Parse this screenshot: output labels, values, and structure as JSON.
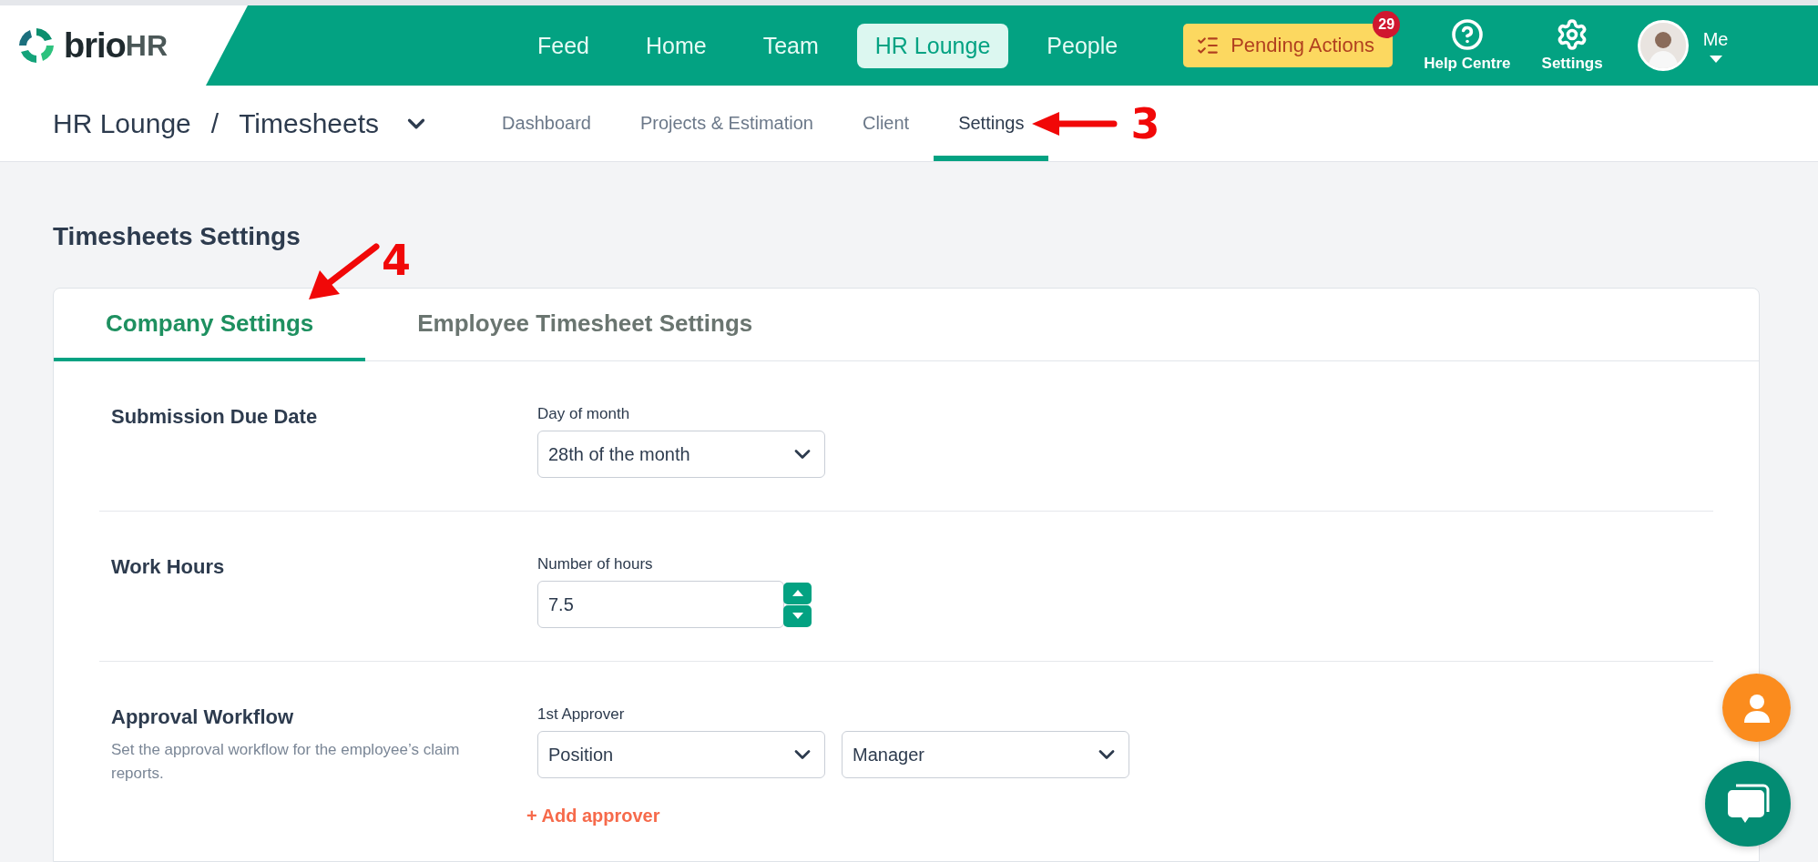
{
  "logo": {
    "brand": "brio",
    "suffix": "HR"
  },
  "top_nav": [
    {
      "label": "Feed",
      "selected": false
    },
    {
      "label": "Home",
      "selected": false
    },
    {
      "label": "Team",
      "selected": false
    },
    {
      "label": "HR Lounge",
      "selected": true
    },
    {
      "label": "People",
      "selected": false
    }
  ],
  "pending_actions": {
    "label": "Pending Actions",
    "badge": "29"
  },
  "utilities": [
    {
      "label": "Help Centre",
      "kind": "help"
    },
    {
      "label": "Settings",
      "kind": "settings"
    }
  ],
  "user_menu": {
    "label": "Me"
  },
  "breadcrumb": {
    "section": "HR Lounge",
    "separator": "/",
    "page": "Timesheets"
  },
  "sub_tabs": [
    {
      "label": "Dashboard",
      "selected": false
    },
    {
      "label": "Projects & Estimation",
      "selected": false
    },
    {
      "label": "Client",
      "selected": false
    },
    {
      "label": "Settings",
      "selected": true
    }
  ],
  "subnav_annotation": {
    "number": "3",
    "kind": "left"
  },
  "page_title": "Timesheets Settings",
  "settings_tabs": [
    {
      "label": "Company Settings",
      "selected": true
    },
    {
      "label": "Employee Timesheet Settings",
      "selected": false
    }
  ],
  "tabs_annotation": {
    "number": "4",
    "kind": "diagonal"
  },
  "sections": [
    {
      "title": "Submission Due Date",
      "fields": [
        {
          "kind": "select",
          "label": "Day of month",
          "values": [
            "28th of the month"
          ]
        }
      ]
    },
    {
      "title": "Work Hours",
      "fields": [
        {
          "kind": "number",
          "label": "Number of hours",
          "values": [
            "7.5"
          ]
        }
      ]
    },
    {
      "title": "Approval Workflow",
      "description": "Set the approval workflow for the employee’s claim reports.",
      "fields": [
        {
          "kind": "select",
          "label": "1st Approver",
          "values": [
            "Position",
            "Manager"
          ]
        }
      ],
      "add_link": "+ Add approver"
    }
  ]
}
